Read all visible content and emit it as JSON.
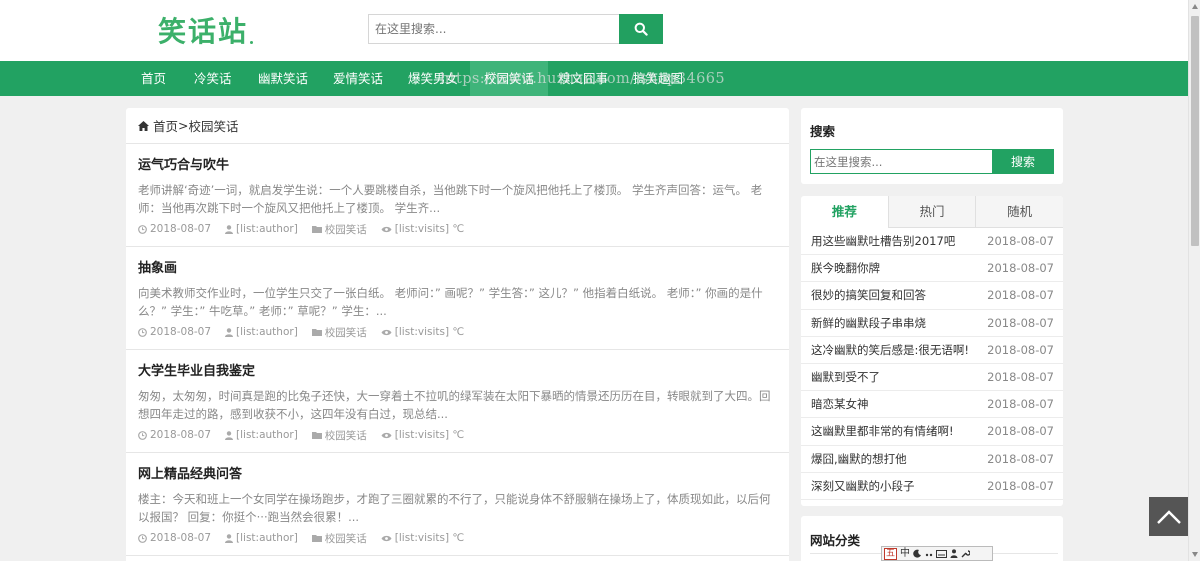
{
  "header": {
    "logo_text": "笑话站",
    "search_placeholder": "在这里搜索..."
  },
  "nav": {
    "items": [
      {
        "label": "首页"
      },
      {
        "label": "冷笑话"
      },
      {
        "label": "幽默笑话"
      },
      {
        "label": "爱情笑话"
      },
      {
        "label": "爆笑男女"
      },
      {
        "label": "校园笑话"
      },
      {
        "label": "糗文囧事"
      },
      {
        "label": "搞笑趣图"
      }
    ],
    "watermark": "https://www.huzhan.com/ishop34665"
  },
  "breadcrumb": {
    "home": "首页",
    "separator": ">",
    "current": "校园笑话"
  },
  "articles": [
    {
      "title": "运气巧合与吹牛",
      "summary": "老师讲解‘奇迹’一词，就启发学生说：一个人要跳楼自杀，当他跳下时一个旋风把他托上了楼顶。 学生齐声回答：运气。 老师：当他再次跳下时一个旋风又把他托上了楼顶。 学生齐...",
      "date": "2018-08-07",
      "author": "[list:author]",
      "category": "校园笑话",
      "visits": "[list:visits] ℃"
    },
    {
      "title": "抽象画",
      "summary": "向美术教师交作业时，一位学生只交了一张白纸。 老师问：” 画呢？” 学生答：” 这儿？” 他指着白纸说。 老师：” 你画的是什么？” 学生：” 牛吃草。” 老师：” 草呢？” 学生：...",
      "date": "2018-08-07",
      "author": "[list:author]",
      "category": "校园笑话",
      "visits": "[list:visits] ℃"
    },
    {
      "title": "大学生毕业自我鉴定",
      "summary": "匆匆，太匆匆，时间真是跑的比兔子还快，大一穿着土不拉叽的绿军装在太阳下暴晒的情景还历历在目，转眼就到了大四。回想四年走过的路，感到收获不小，这四年没有白过，现总结...",
      "date": "2018-08-07",
      "author": "[list:author]",
      "category": "校园笑话",
      "visits": "[list:visits] ℃"
    },
    {
      "title": "网上精品经典问答",
      "summary": "楼主：今天和班上一个女同学在操场跑步，才跑了三圈就累的不行了，只能说身体不舒服躺在操场上了，体质现如此，以后何以报国？ 回复：你挺个···跑当然会很累！...",
      "date": "2018-08-07",
      "author": "[list:author]",
      "category": "校园笑话",
      "visits": "[list:visits] ℃"
    }
  ],
  "sidebar": {
    "search": {
      "title": "搜索",
      "placeholder": "在这里搜索...",
      "button": "搜索"
    },
    "tabs": [
      {
        "label": "推荐"
      },
      {
        "label": "热门"
      },
      {
        "label": "随机"
      }
    ],
    "ranking": [
      {
        "title": "用这些幽默吐槽告别2017吧",
        "date": "2018-08-07"
      },
      {
        "title": "朕今晚翻你牌",
        "date": "2018-08-07"
      },
      {
        "title": "很妙的搞笑回复和回答",
        "date": "2018-08-07"
      },
      {
        "title": "新鲜的幽默段子串串烧",
        "date": "2018-08-07"
      },
      {
        "title": "这冷幽默的笑后感是:很无语啊!",
        "date": "2018-08-07"
      },
      {
        "title": "幽默到受不了",
        "date": "2018-08-07"
      },
      {
        "title": "暗恋某女神",
        "date": "2018-08-07"
      },
      {
        "title": "这幽默里都非常的有情绪啊!",
        "date": "2018-08-07"
      },
      {
        "title": "爆囧,幽默的想打他",
        "date": "2018-08-07"
      },
      {
        "title": "深刻又幽默的小段子",
        "date": "2018-08-07"
      }
    ],
    "categories_title": "网站分类"
  },
  "ime": {
    "badge": "五",
    "mode": "中"
  },
  "colors": {
    "brand_green": "#22a262",
    "nav_active": "#3fb47a",
    "logo_green": "#3cb06a"
  }
}
